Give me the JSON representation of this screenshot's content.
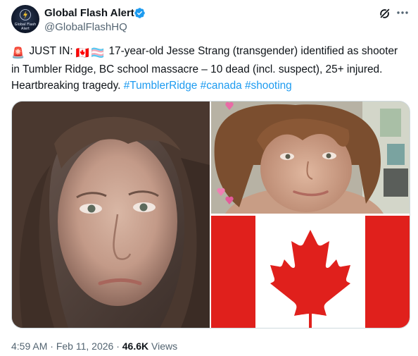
{
  "account": {
    "display_name": "Global Flash Alert",
    "handle": "@GlobalFlashHQ",
    "avatar_text": "Global Flash\nAlert",
    "verified_icon": "verified-badge-icon"
  },
  "header_actions": {
    "grok_icon": "grok-icon",
    "more_icon": "more-icon"
  },
  "post": {
    "alert_emoji": "🚨",
    "lead": "JUST IN:",
    "flag_emoji_1": "🇨🇦",
    "flag_emoji_2": "🏳️‍⚧️",
    "text": "17-year-old Jesse Strang (transgender) identified as shooter in Tumbler Ridge, BC school massacre – 10 dead (incl. suspect), 25+ injured.  Heartbreaking tragedy.",
    "hashtags": [
      "#TumblerRidge",
      "#canada",
      "#shooting"
    ]
  },
  "media": {
    "images": [
      "portrait-photo-long-hair",
      "portrait-photo-curly-hair",
      "canada-flag-image"
    ]
  },
  "meta": {
    "time": "4:59 AM",
    "separator": "·",
    "date": "Feb 11, 2026",
    "views_count": "46.6K",
    "views_label": "Views"
  },
  "colors": {
    "link": "#1d9bf0",
    "secondary_text": "#536471",
    "verified": "#1d9bf0",
    "flag_red": "#e0201c"
  }
}
